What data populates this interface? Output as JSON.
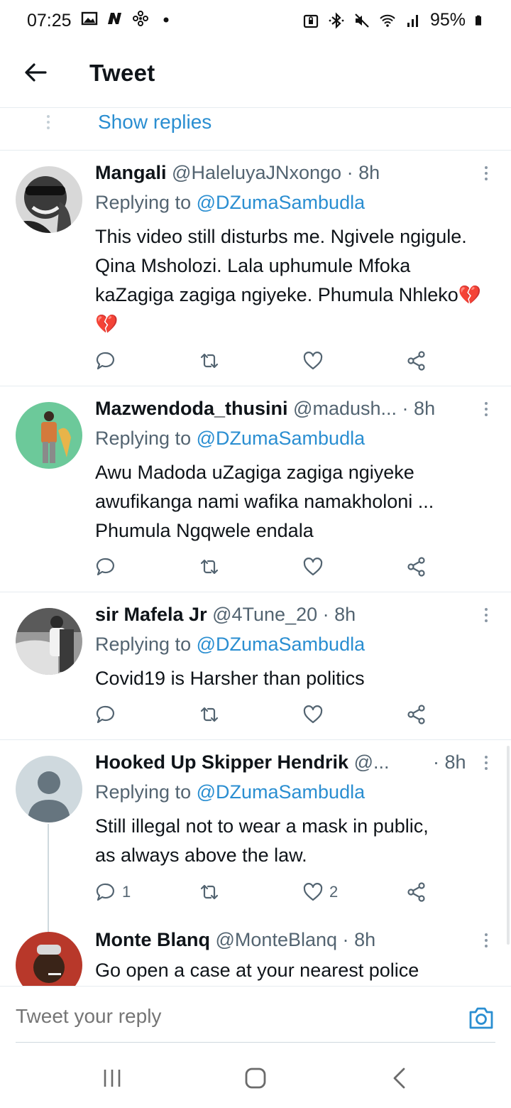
{
  "status_bar": {
    "time": "07:25",
    "battery": "95%",
    "left_icons": [
      "gallery-icon",
      "n-logo-icon",
      "pinwheel-icon",
      "dot-icon"
    ],
    "right_icons": [
      "lock-box-icon",
      "bluetooth-icon",
      "mute-icon",
      "wifi-icon",
      "signal-icon",
      "battery-icon"
    ]
  },
  "header": {
    "back_icon": "arrow-left-icon",
    "title": "Tweet"
  },
  "thread": {
    "show_replies": "Show replies"
  },
  "accent_color": "#2a8ed1",
  "tweets": [
    {
      "name": "Mangali",
      "handle": "@HaleluyaJNxongo",
      "dot": "·",
      "time": "8h",
      "replying_prefix": "Replying to ",
      "replying_to": "@DZumaSambudla",
      "text": "This video still disturbs me. Ngivele ngigule. Qina Msholozi. Lala uphumule Mfoka kaZagiga zagiga ngiyeke. Phumula Nhleko",
      "emoji": "💔💔",
      "reply_count": "",
      "retweet_count": "",
      "like_count": ""
    },
    {
      "name": "Mazwendoda_thusini",
      "handle": "@madush...",
      "dot": "·",
      "time": "8h",
      "replying_prefix": "Replying to ",
      "replying_to": "@DZumaSambudla",
      "text_lines": [
        "Awu Madoda uZagiga zagiga ngiyeke",
        "awufikanga nami wafika namakholoni ...",
        "Phumula Ngqwele endala"
      ],
      "reply_count": "",
      "retweet_count": "",
      "like_count": ""
    },
    {
      "name": "sir Mafela Jr",
      "handle": "@4Tune_20",
      "dot": "·",
      "time": "8h",
      "replying_prefix": "Replying to ",
      "replying_to": "@DZumaSambudla",
      "text": "Covid19 is Harsher than politics",
      "reply_count": "",
      "retweet_count": "",
      "like_count": ""
    },
    {
      "name": "Hooked Up Skipper Hendrik",
      "handle": "@...",
      "dot": "·",
      "time": "8h",
      "replying_prefix": "Replying to ",
      "replying_to": "@DZumaSambudla",
      "text_lines": [
        "Still illegal not to wear a mask in public,",
        "as always above the law."
      ],
      "reply_count": "1",
      "retweet_count": "",
      "like_count": "2"
    },
    {
      "name": "Monte Blanq",
      "handle": "@MonteBlanq",
      "dot": "·",
      "time": "8h",
      "text": "Go open a case at your nearest police"
    }
  ],
  "reply_bar": {
    "placeholder": "Tweet your reply",
    "camera_icon": "camera-icon"
  },
  "nav_bar": {
    "icons": [
      "recent-apps-icon",
      "home-icon",
      "back-icon"
    ]
  }
}
